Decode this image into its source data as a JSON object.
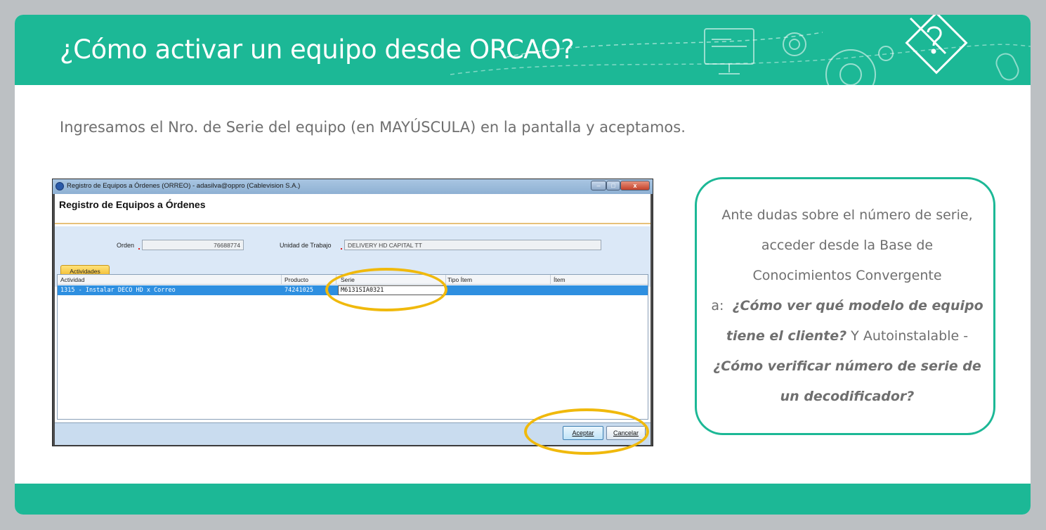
{
  "header": {
    "title": "¿Cómo activar un equipo desde ORCAO?"
  },
  "intro": "Ingresamos el Nro. de Serie del equipo (en MAYÚSCULA) en la pantalla y aceptamos.",
  "window": {
    "title": "Registro de Equipos a Órdenes (ORREO) - adasilva@oppro (Cablevision S.A.)",
    "form_title": "Registro de Equipos a Órdenes",
    "orden_label": "Orden",
    "orden_value": "76688774",
    "unidad_label": "Unidad de Trabajo",
    "unidad_value": "DELIVERY HD CAPITAL TT",
    "tab_label": "Actividades",
    "columns": [
      "Actividad",
      "Producto",
      "Serie",
      "Tipo Ítem",
      "Ítem"
    ],
    "row": {
      "actividad": "1315 - Instalar DECO HD x Correo",
      "producto": "74241025",
      "serie": "M6131SIA0321",
      "tipo_item": "",
      "item": ""
    },
    "buttons": {
      "aceptar": "Aceptar",
      "cancelar": "Cancelar"
    }
  },
  "callout": {
    "line1": "Ante dudas sobre el número de serie,",
    "line2": "acceder desde la Base de",
    "line3": "Conocimientos Convergente",
    "line4_prefix": "a:",
    "line4_bold": "¿Cómo ver qué modelo de equipo",
    "line5_bold": "tiene el cliente?",
    "line5_rest": "Y Autoinstalable -",
    "line6_bold": "¿Cómo verificar número de serie de",
    "line7_bold": "un decodificador?"
  },
  "colors": {
    "brand": "#1cb896",
    "highlight": "#f0b90c",
    "text": "#6f6f6f"
  }
}
